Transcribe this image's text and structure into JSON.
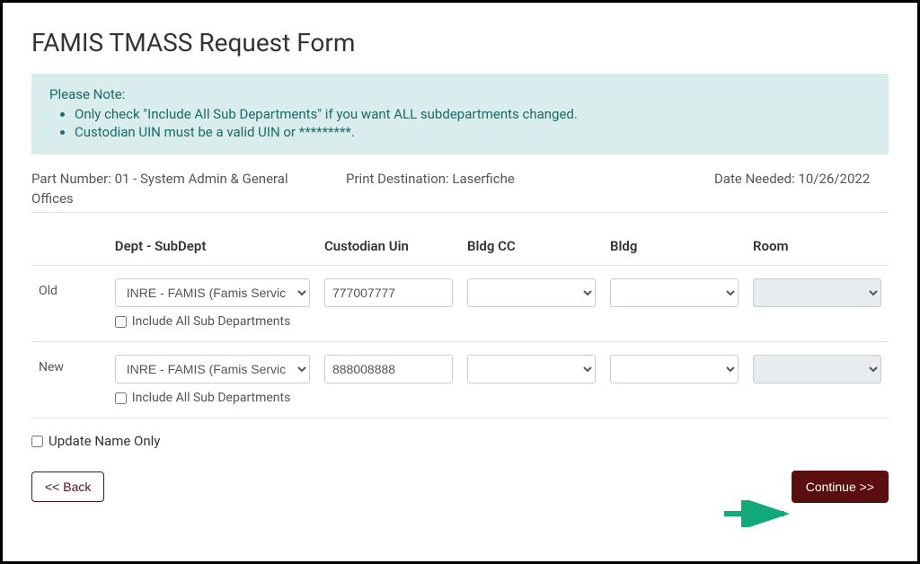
{
  "title": "FAMIS TMASS Request Form",
  "note": {
    "heading": "Please Note:",
    "items": [
      "Only check \"Include All Sub Departments\" if you want ALL subdepartments changed.",
      "Custodian UIN must be a valid UIN or *********."
    ]
  },
  "meta": {
    "part_label": "Part Number:",
    "part_value": "01 - System Admin & General",
    "part_line2": "Offices",
    "print_label": "Print Destination:",
    "print_value": "Laserfiche",
    "date_label": "Date Needed:",
    "date_value": "10/26/2022"
  },
  "columns": {
    "dept": "Dept - SubDept",
    "uin": "Custodian Uin",
    "bldgcc": "Bldg CC",
    "bldg": "Bldg",
    "room": "Room"
  },
  "rows": {
    "old": {
      "label": "Old",
      "dept": "INRE - FAMIS (Famis Servic",
      "uin": "777007777",
      "include_label": "Include All Sub Departments"
    },
    "new": {
      "label": "New",
      "dept": "INRE - FAMIS (Famis Servic",
      "uin": "888008888",
      "include_label": "Include All Sub Departments"
    }
  },
  "update_name_only": "Update Name Only",
  "buttons": {
    "back": "<< Back",
    "continue": "Continue >>"
  }
}
